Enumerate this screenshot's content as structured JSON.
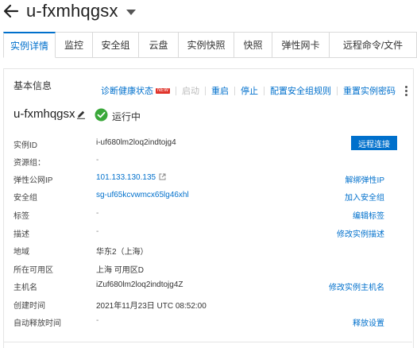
{
  "header": {
    "title": "u-fxmhqgsx"
  },
  "tabs": [
    {
      "label": "实例详情",
      "active": true
    },
    {
      "label": "监控",
      "active": false
    },
    {
      "label": "安全组",
      "active": false
    },
    {
      "label": "云盘",
      "active": false
    },
    {
      "label": "实例快照",
      "active": false
    },
    {
      "label": "快照",
      "active": false
    },
    {
      "label": "弹性网卡",
      "active": false
    },
    {
      "label": "远程命令/文件",
      "active": false
    }
  ],
  "basic_info": {
    "section_title": "基本信息",
    "actions": {
      "diagnose": "诊断健康状态",
      "new_badge": "NEW",
      "start": "启动",
      "restart": "重启",
      "stop": "停止",
      "config_sg_rules": "配置安全组规则",
      "reset_password": "重置实例密码"
    },
    "instance_name": "u-fxmhqgsx",
    "status": "运行中",
    "status_color": "#3aa83a",
    "rows": {
      "instance_id": {
        "label": "实例ID",
        "value": "i-uf680lm2loq2indtojg4",
        "button": "远程连接"
      },
      "resource_group": {
        "label": "资源组：",
        "value": "-"
      },
      "public_ip": {
        "label": "弹性公网IP",
        "value": "101.133.130.135",
        "op": "解绑弹性IP"
      },
      "security_group": {
        "label": "安全组",
        "value": "sg-uf65kcvwmcx65lg46xhl",
        "op": "加入安全组"
      },
      "tags": {
        "label": "标签",
        "value": "-",
        "op": "编辑标签"
      },
      "description": {
        "label": "描述",
        "value": "-",
        "op": "修改实例描述"
      },
      "region": {
        "label": "地域",
        "value": "华东2（上海）"
      },
      "zone": {
        "label": "所在可用区",
        "value": "上海 可用区D"
      },
      "hostname": {
        "label": "主机名",
        "value": "iZuf680lm2loq2indtojg4Z",
        "op": "修改实例主机名"
      },
      "created": {
        "label": "创建时间",
        "value": "2021年11月23日 UTC 08:52:00"
      },
      "auto_release": {
        "label": "自动释放时间",
        "value": "-",
        "op": "释放设置"
      }
    }
  },
  "colors": {
    "accent": "#0070cc",
    "badge": "#e0342b"
  }
}
